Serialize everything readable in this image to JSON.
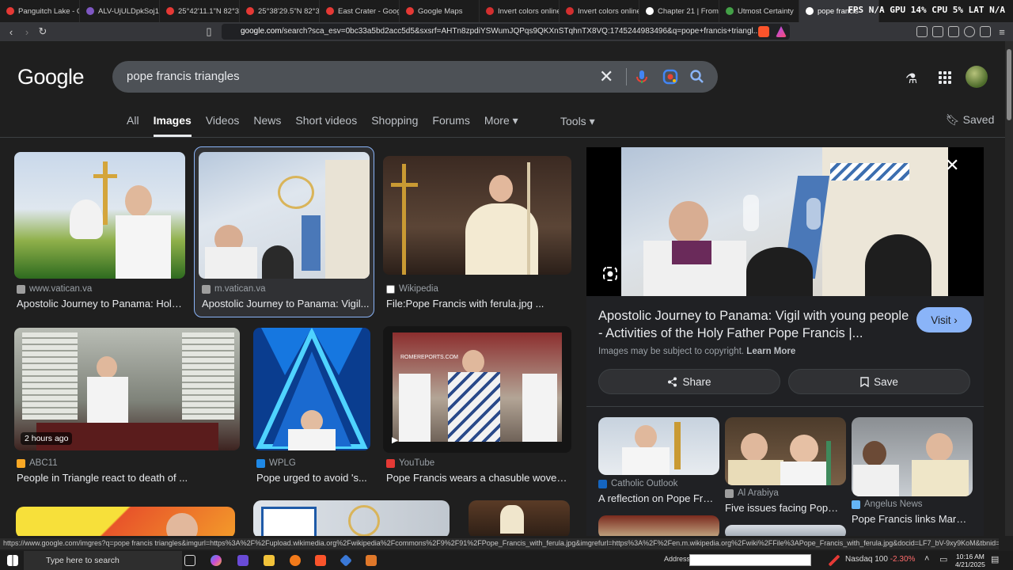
{
  "browser": {
    "tabs": [
      {
        "title": "Panguitch Lake - G",
        "color": "#e53935"
      },
      {
        "title": "ALV-UjULDpkSoj1e",
        "color": "#7e57c2"
      },
      {
        "title": "25°42'11.1\"N 82°31",
        "color": "#e53935"
      },
      {
        "title": "25°38'29.5\"N 82°31",
        "color": "#e53935"
      },
      {
        "title": "East Crater - Goog",
        "color": "#e53935"
      },
      {
        "title": "Google Maps",
        "color": "#e53935"
      },
      {
        "title": "Invert colors online",
        "color": "#d32f2f"
      },
      {
        "title": "Invert colors online",
        "color": "#d32f2f"
      },
      {
        "title": "Chapter 21 | From",
        "color": "#ffffff"
      },
      {
        "title": "Utmost Certainty",
        "color": "#43a047"
      },
      {
        "title": "pope francis",
        "color": "#ffffff",
        "active": true
      }
    ],
    "perf_overlay": "FPS N/A  GPU 14%  CPU 5%  LAT N/A",
    "url_domain": "google.com",
    "url_rest": "/search?sca_esv=0bc33a5bd2acc5d5&sxsrf=AHTn8zpdiYSWumJQPqs9QKXnSTqhnTX8VQ:1745244983496&q=pope+francis+triangl..."
  },
  "google": {
    "logo": "Google",
    "query": "pope francis triangles",
    "tabs": [
      "All",
      "Images",
      "Videos",
      "News",
      "Short videos",
      "Shopping",
      "Forums",
      "More ▾"
    ],
    "active_tab": "Images",
    "tools": "Tools ▾",
    "saved": "Saved"
  },
  "results": [
    {
      "source": "www.vatican.va",
      "title": "Apostolic Journey to Panama: Holy...",
      "fav": "#9e9e9e"
    },
    {
      "source": "m.vatican.va",
      "title": "Apostolic Journey to Panama: Vigil...",
      "fav": "#9e9e9e"
    },
    {
      "source": "Wikipedia",
      "title": "File:Pope Francis with ferula.jpg ...",
      "fav": "#ffffff"
    },
    {
      "source": "ABC11",
      "title": "People in Triangle react to death of ...",
      "fav": "#f9a825",
      "badge": "2 hours ago"
    },
    {
      "source": "WPLG",
      "title": "Pope urged to avoid 's...",
      "fav": "#1e88e5"
    },
    {
      "source": "YouTube",
      "title": "Pope Francis wears a chasuble woven ...",
      "fav": "#e53935",
      "badge": "▶"
    }
  ],
  "panel": {
    "title": "Apostolic Journey to Panama: Vigil with young people - Activities of the Holy Father Pope Francis |...",
    "visit": "Visit ›",
    "copyright": "Images may be subject to copyright.",
    "learn_more": "Learn More",
    "share": "Share",
    "save": "Save",
    "related": [
      {
        "source": "Catholic Outlook",
        "title": "A reflection on Pope Fra...",
        "fav": "#1565c0"
      },
      {
        "source": "Al Arabiya",
        "title": "Five issues facing Pope ...",
        "fav": "#9e9e9e"
      },
      {
        "source": "Angelus News",
        "title": "Pope Francis links Mary'...",
        "fav": "#64b5f6"
      }
    ]
  },
  "status_url": "https://www.google.com/imgres?q=pope francis triangles&imgurl=https%3A%2F%2Fupload.wikimedia.org%2Fwikipedia%2Fcommons%2F9%2F91%2FPope_Francis_with_ferula.jpg&imgrefurl=https%3A%2F%2Fen.m.wikipedia.org%2Fwiki%2FFile%3APope_Francis_with_ferula.jpg&docid=LF7_bV-9xy9KoM&tbnid=J8TAvv16JNg8CM&vet=12ahUKEwii5uGb...",
  "taskbar": {
    "search_placeholder": "Type here to search",
    "address_label": "Address",
    "ticker": "Nasdaq 100",
    "ticker_change": "-2.30%",
    "time": "10:16 AM",
    "date": "4/21/2025"
  }
}
